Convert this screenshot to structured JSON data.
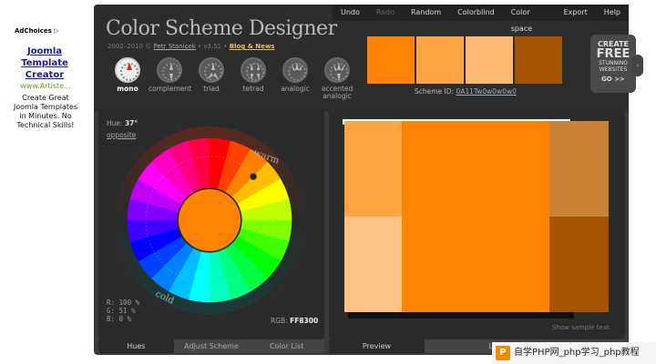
{
  "ad": {
    "choices_label": "AdChoices",
    "title": "Joomla Template Creator",
    "url": "www.Artiste...",
    "body": "Create Great Joomla Templates in Minutes. No Technical Skills!"
  },
  "menu": [
    "Undo",
    "Redo",
    "Random",
    "Colorblind",
    "Color space",
    "Export",
    "Help"
  ],
  "app": {
    "title": "Color Scheme Designer",
    "subtitle_prefix": "2002–2010 ©",
    "author": "Petr Stanicek",
    "version": "• v3.51 •",
    "blog": "Blog & News"
  },
  "modes": [
    {
      "label": "mono",
      "selected": true
    },
    {
      "label": "complement",
      "selected": false
    },
    {
      "label": "triad",
      "selected": false
    },
    {
      "label": "tetrad",
      "selected": false
    },
    {
      "label": "analogic",
      "selected": false
    },
    {
      "label": "accented analogic",
      "selected": false
    }
  ],
  "swatches": [
    "#ff8300",
    "#ffa443",
    "#ffb973",
    "#a55500"
  ],
  "scheme": {
    "label": "Scheme ID:",
    "id": "0A11Tw0w0w0w0"
  },
  "create_ad": {
    "l1": "CREATE",
    "l2": "FREE",
    "l3": "STUNNING WEBSITES",
    "l4": "GO >>"
  },
  "wheel": {
    "hue_label": "Hue:",
    "hue_value": "37°",
    "opposite": "opposite",
    "warm": "warm",
    "cold": "cold",
    "r": "R: 100 %",
    "g": "G:  51 %",
    "b": "B:   0 %",
    "rgb_label": "RGB:",
    "rgb_value": "FF8300",
    "center_color": "#ff8300"
  },
  "left_tabs": [
    "Hues",
    "Adjust Scheme",
    "Color List"
  ],
  "right_tabs": [
    "Preview",
    "Light page example"
  ],
  "preview": {
    "show_sample": "Show sample text",
    "colors": {
      "main": "#ff8300",
      "light1": "#ffa443",
      "light2": "#ffc285",
      "dark1": "#c88135",
      "dark2": "#a55500"
    }
  },
  "watermark": {
    "logo": "P",
    "text": "自学PHP网_php学习_php教程"
  }
}
